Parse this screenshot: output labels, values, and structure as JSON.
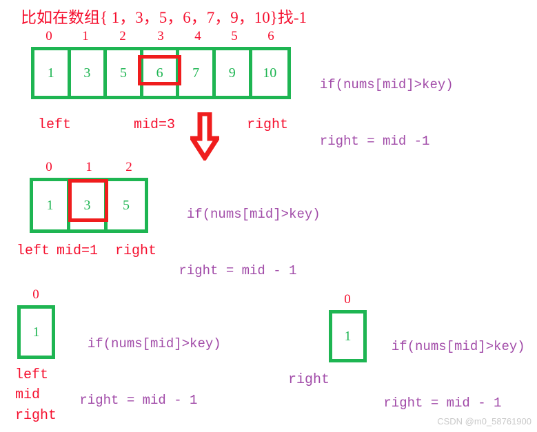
{
  "title": "比如在数组{ 1，3，5，6，7，9，10}找-1",
  "colors": {
    "red": "#f50f2e",
    "green": "#1eb552",
    "purple": "#a14ba8",
    "highlight_red": "#ef1d1d",
    "watermark_gray": "#c9c9c9"
  },
  "steps": [
    {
      "indices": [
        "0",
        "1",
        "2",
        "3",
        "4",
        "5",
        "6"
      ],
      "values": [
        "1",
        "3",
        "5",
        "6",
        "7",
        "9",
        "10"
      ],
      "highlight_index": 3,
      "labels": {
        "left": "left",
        "mid": "mid=3",
        "right": "right"
      },
      "code": {
        "line1": "if(nums[mid]>key)",
        "line2": "  right = mid -1"
      }
    },
    {
      "indices": [
        "0",
        "1",
        "2"
      ],
      "values": [
        "1",
        "3",
        "5"
      ],
      "highlight_index": 1,
      "labels": {
        "left": "left",
        "mid": "mid=1",
        "right": "right"
      },
      "code": {
        "line1": "if(nums[mid]>key)",
        "line2": " right = mid - 1"
      }
    },
    {
      "indices": [
        "0"
      ],
      "values": [
        "1"
      ],
      "highlight_index": -1,
      "labels": {
        "left": "left",
        "mid": "mid",
        "right": "right"
      },
      "code": {
        "line1": "if(nums[mid]>key)",
        "line2": " right = mid - 1"
      }
    },
    {
      "indices": [
        "0"
      ],
      "values": [
        "1"
      ],
      "highlight_index": -1,
      "labels": {
        "right": "right"
      },
      "code": {
        "line1": "if(nums[mid]>key)",
        "line2": " right = mid - 1"
      }
    }
  ],
  "arrow": {
    "name": "down-arrow",
    "direction": "down"
  },
  "watermark": "CSDN @m0_58761900"
}
